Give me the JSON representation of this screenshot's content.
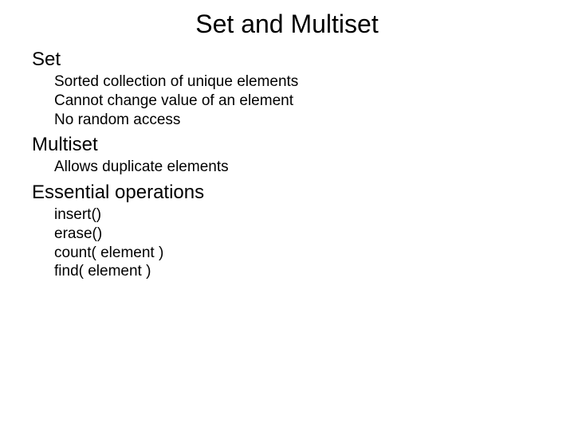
{
  "title": "Set and Multiset",
  "sections": {
    "set": {
      "heading": "Set",
      "items": [
        "Sorted collection of unique elements",
        "Cannot change value of an element",
        "No random access"
      ]
    },
    "multiset": {
      "heading": "Multiset",
      "items": [
        "Allows duplicate elements"
      ]
    },
    "ops": {
      "heading": "Essential operations",
      "items": [
        "insert()",
        "erase()",
        "count( element )",
        "find( element )"
      ]
    }
  }
}
